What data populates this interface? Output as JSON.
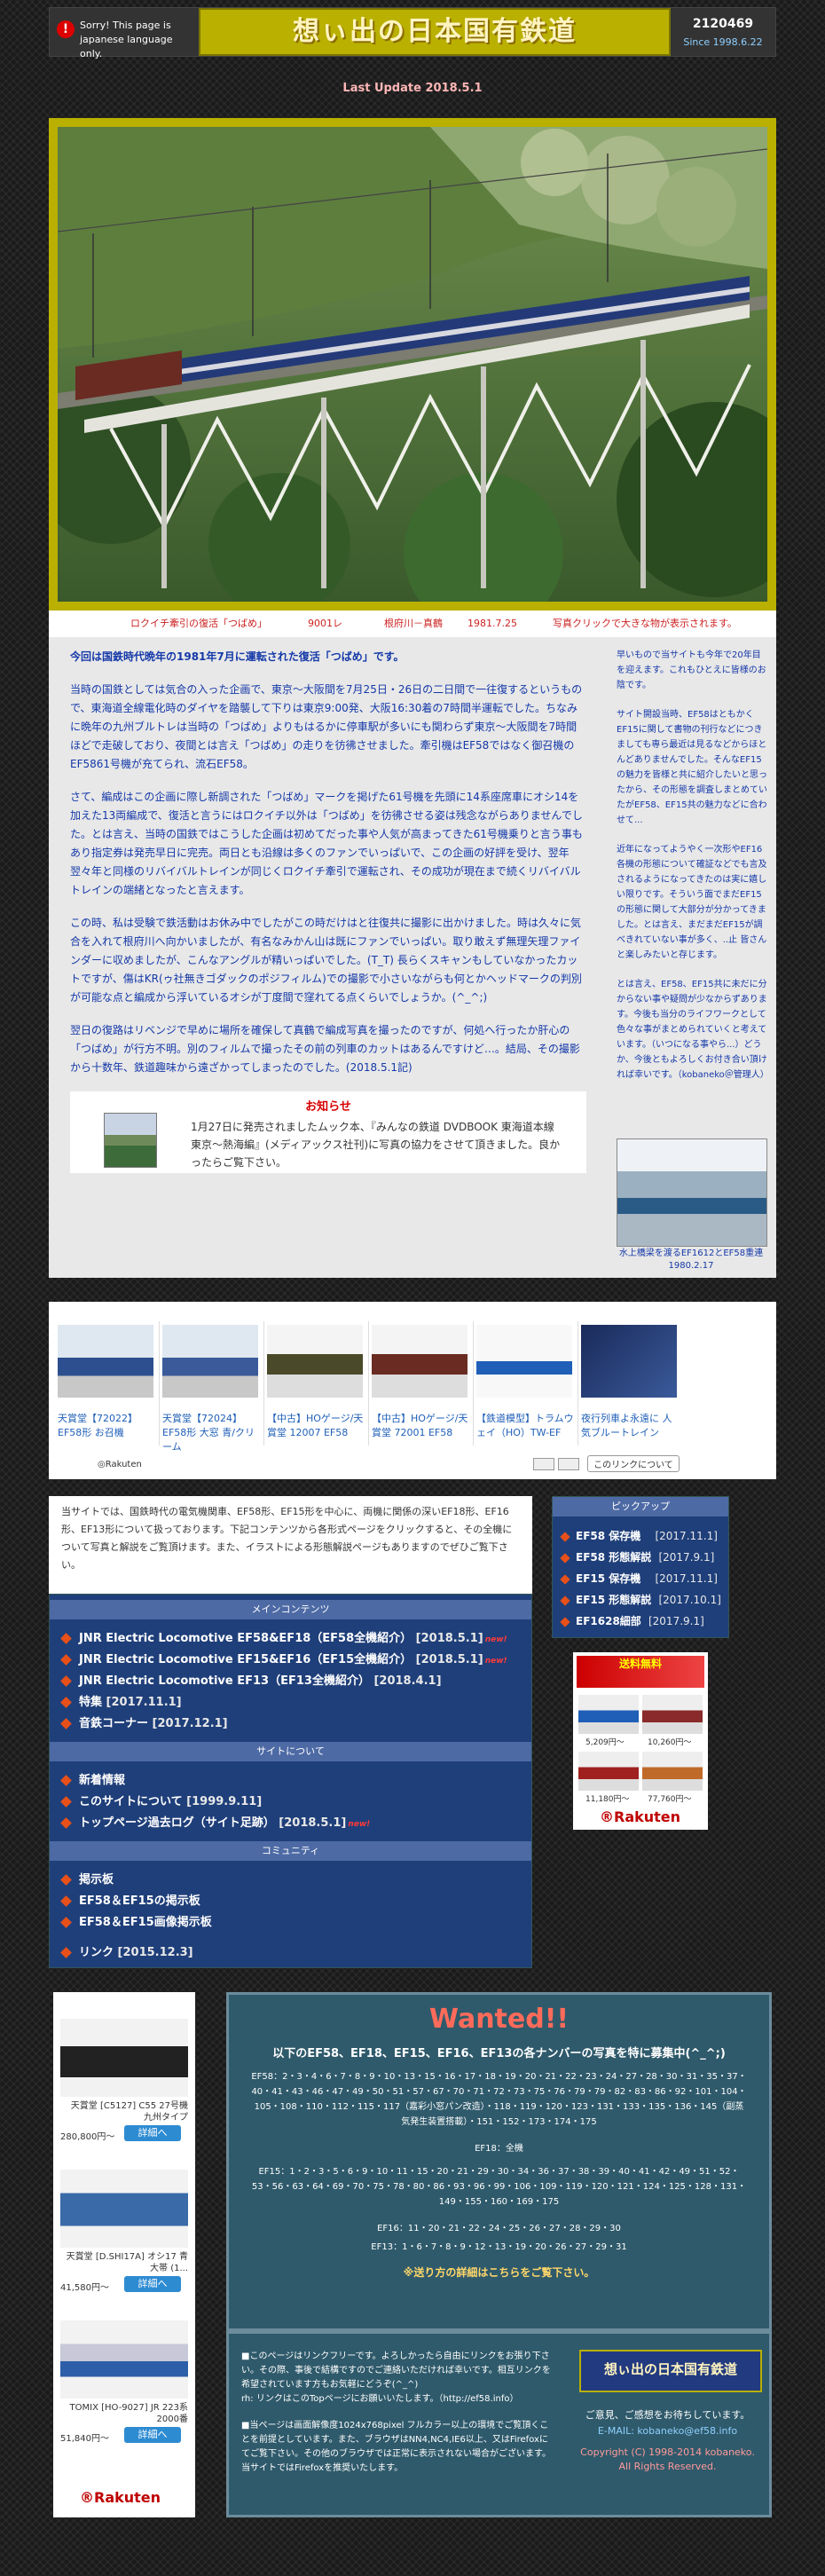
{
  "header": {
    "sorry_text": "Sorry! This page is japanese language only.",
    "title": "想ぃ出の日本国有鉄道",
    "counter": "2120469",
    "since": "Since 1998.6.22"
  },
  "last_update": "Last Update 2018.5.1",
  "photo_caption": {
    "train": "ロクイチ牽引の復活「つばめ」",
    "number": "9001レ",
    "place": "根府川－真鶴",
    "date": "1981.7.25",
    "note": "写真クリックで大きな物が表示されます。"
  },
  "main_text": [
    "今回は国鉄時代晩年の1981年7月に運転された復活「つばめ」です。",
    "当時の国鉄としては気合の入った企画で、東京～大阪間を7月25日・26日の二日間で一往復するというもので、東海道全線電化時のダイヤを踏襲して下りは東京9:00発、大阪16:30着の7時間半運転でした。ちなみに晩年の九州ブルトレは当時の「つばめ」よりもはるかに停車駅が多いにも関わらず東京～大阪間を7時間ほどで走破しており、夜間とは言え「つばめ」の走りを彷彿させました。牽引機はEF58ではなく御召機のEF5861号機が充てられ、流石EF58。",
    "さて、編成はこの企画に際し新調された「つばめ」マークを掲げた61号機を先頭に14系座席車にオシ14を加えた13両編成で、復活と言うにはロクイチ以外は「つばめ」を彷彿させる姿は残念ながらありませんでした。とは言え、当時の国鉄ではこうした企画は初めてだった事や人気が高まってきた61号機乗りと言う事もあり指定券は発売早日に完売。両日とも沿線は多くのファンでいっぱいで、この企画の好評を受け、翌年翌々年と同様のリバイバルトレインが同じくロクイチ牽引で運転され、その成功が現在まで続くリバイバルトレインの端緒となったと言えます。",
    "この時、私は受験で鉄活動はお休み中でしたがこの時だけはと往復共に撮影に出かけました。時は久々に気合を入れて根府川へ向かいましたが、有名なみかん山は既にファンでいっぱい。取り敢えず無理矢理ファインダーに収めましたが、こんなアングルが精いっぱいでした。(T_T) 長らくスキャンもしていなかったカットですが、傷はKR(ゥ社無きゴダックのポジフィルム)での撮影で小さいながらも何とかヘッドマークの判別が可能な点と編成から浮いているオシが丁度間で窪れてる点くらいでしょうか。(^_^;)",
    "翌日の復路はリベンジで早めに場所を確保して真鶴で編成写真を撮ったのですが、何処へ行ったか肝心の「つばめ」が行方不明。別のフィルムで撮ったその前の列車のカットはあるんですけど…。結局、その撮影から十数年、鉄道趣味から遠ざかってしまったのでした。(2018.5.1記)"
  ],
  "news": {
    "heading": "お知らせ",
    "text": "1月27日に発売されましたムック本、『みんなの鉄道 DVDBOOK 東海道本線 東京～熱海編』(メディアックス社刊)に写真の協力をさせて頂きました。良かったらご覧下さい。"
  },
  "side_text": [
    "早いもので当サイトも今年で20年目を迎えます。これもひとえに皆様のお陰です。",
    "サイト開設当時、EF58はともかくEF15に関して書物の刊行などにつきましても専ら最近は見るなどからほとんどありませんでした。そんなEF15の魅力を皆様と共に紹介したいと思ったから、その形態を調査しまとめていたがEF58、EF15共の魅力などに合わせて...",
    "近年になってようやく一次形やEF16各機の形態について確証などでも言及されるようになってきたのは実に嬉しい限りです。そういう面でまだEF15の形態に関して大部分が分かってきました。とは言え、まだまだEF15が調べきれていない事が多く、..止 皆さんと楽しみたいと存じます。",
    "とは言え、EF58、EF15共に未だに分からない事や疑問が少なからずあります。今後も当分のライフワークとして色々な事がまとめられていくと考えています。（いつになる事やら...）どうか、今後ともよろしくお付き合い頂ければ幸いです。（kobaneko＠管理人）"
  ],
  "side_photo_caption": "水上橋梁を渡るEF1612とEF58重連 1980.2.17",
  "products": [
    {
      "label": "天賞堂【72022】EF58形 お召機"
    },
    {
      "label": "天賞堂【72024】EF58形 大窓 青/クリーム"
    },
    {
      "label": "【中古】HOゲージ/天賞堂 12007 EF58"
    },
    {
      "label": "【中古】HOゲージ/天賞堂 72001 EF58"
    },
    {
      "label": "【鉄道模型】トラムウェイ（HO）TW-EF"
    },
    {
      "label": "夜行列車よ永遠に 人気ブルートレイン"
    }
  ],
  "strip_footer": {
    "logo": "◎Rakuten",
    "more": "このリンクについて"
  },
  "intro": "当サイトでは、国鉄時代の電気機関車、EF58形、EF15形を中心に、両機に関係の深いEF18形、EF16形、EF13形について扱っております。下記コンテンツから各形式ページをクリックすると、その全機について写真と解説をご覧頂けます。また、イラストによる形態解説ページもありますのでぜひご覧下さい。",
  "menu": {
    "main_head": "メインコンテンツ",
    "main_items": [
      {
        "text": "JNR Electric Locomotive EF58&EF18（EF58全機紹介）",
        "date": "[2018.5.1]",
        "new": "new!"
      },
      {
        "text": "JNR Electric Locomotive EF15&EF16（EF15全機紹介）",
        "date": "[2018.5.1]",
        "new": "new!"
      },
      {
        "text": "JNR Electric Locomotive EF13（EF13全機紹介）",
        "date": "[2018.4.1]",
        "new": ""
      },
      {
        "text": "特集",
        "date": "[2017.11.1]",
        "new": ""
      },
      {
        "text": "音鉄コーナー",
        "date": "[2017.12.1]",
        "new": ""
      }
    ],
    "site_head": "サイトについて",
    "site_items": [
      {
        "text": "新着情報",
        "date": "",
        "new": ""
      },
      {
        "text": "このサイトについて",
        "date": "[1999.9.11]",
        "new": ""
      },
      {
        "text": "トップページ過去ログ（サイト足跡）",
        "date": "[2018.5.1]",
        "new": "new!"
      }
    ],
    "comm_head": "コミュニティ",
    "comm_items": [
      {
        "text": "掲示板",
        "date": "",
        "new": ""
      },
      {
        "text": "EF58＆EF15の掲示板",
        "date": "",
        "new": ""
      },
      {
        "text": "EF58＆EF15画像掲示板",
        "date": "",
        "new": ""
      }
    ],
    "link_item": {
      "text": "リンク",
      "date": "[2015.12.3]"
    }
  },
  "pickup": {
    "head": "ピックアップ",
    "items": [
      {
        "text": "EF58 保存機",
        "date": "[2017.11.1]"
      },
      {
        "text": "EF58 形態解説",
        "date": "[2017.9.1]"
      },
      {
        "text": "EF15 保存機",
        "date": "[2017.11.1]"
      },
      {
        "text": "EF15 形態解説",
        "date": "[2017.10.1]"
      },
      {
        "text": "EF1628細部",
        "date": "[2017.9.1]"
      }
    ]
  },
  "rakuten_right": {
    "banner": "送料無料",
    "prices": [
      "5,209円～",
      "10,260円～",
      "11,180円～",
      "77,760円～"
    ],
    "logo": "®Rakuten"
  },
  "rakuten_left": {
    "items": [
      {
        "name": "天賞堂 [C5127] C55 27号機 九州タイプ",
        "price": "280,800円～",
        "button": "詳細へ"
      },
      {
        "name": "天賞堂 [D.SHI17A] オシ17 青大帯 (1...",
        "price": "41,580円～",
        "button": "詳細へ"
      },
      {
        "name": "TOMIX [HO-9027] JR 223系2000番",
        "price": "51,840円～",
        "button": "詳細へ"
      }
    ],
    "logo": "®Rakuten"
  },
  "wanted": {
    "heading": "Wanted!!",
    "sub": "以下のEF58、EF18、EF15、EF16、EF13の各ナンバーの写真を特に募集中(^_^;)",
    "ef58": "EF58：2・3・4・6・7・8・9・10・13・15・16・17・18・19・20・21・22・23・24・27・28・30・31・35・37・40・41・43・46・47・49・50・51・57・67・70・71・72・73・75・76・79・79・82・83・86・92・101・104・105・108・110・112・115・117（嘉彩小窓パン改造）・118・119・120・123・131・133・135・136・145（副蒸気発生装置搭載）・151・152・173・174・175",
    "ef18": "EF18：全機",
    "ef15": "EF15：1・2・3・5・6・9・10・11・15・20・21・29・30・34・36・37・38・39・40・41・42・49・51・52・53・56・63・64・69・70・75・78・80・86・93・96・99・106・109・119・120・121・124・125・128・131・149・155・160・169・175",
    "ef16": "EF16：11・20・21・22・24・25・26・27・28・29・30",
    "ef13": "EF13：1・6・7・8・9・12・13・19・20・26・27・29・31",
    "note": "※送り方の詳細はこちらをご覧下さい。"
  },
  "footer": {
    "link_note": "■このページはリンクフリーです。よろしかったら自由にリンクをお張り下さい。その際、事後で結構ですのでご連絡いただければ幸いです。相互リンクを希望されています方もお気軽にどうぞ(^_^)",
    "link_url": "rh: リンクはこのTopページにお願いいたします。（http://ef58.info）",
    "browser_note": "■当ページは画面解像度1024x768pixel フルカラー以上の環境でご覧頂くことを前提としています。また、ブラウザはNN4,NC4,IE6以上、又はFirefoxにてご覧下さい。その他のブラウザでは正常に表示されない場合がございます。当サイトではFirefoxを推奨いたします。",
    "logo": "想ぃ出の日本国有鉄道",
    "contact": "ご意見、ご感想をお待ちしています。",
    "email": "E-MAIL: kobaneko@ef58.info",
    "copyright": "Copyright (C) 1998-2014 kobaneko.",
    "rights": "All Rights Reserved."
  },
  "colors": {
    "title_bg": "#b9b000",
    "menu_bg": "#1f3f7a",
    "accent": "#e8501a",
    "wanted": "#ff6b5a"
  }
}
